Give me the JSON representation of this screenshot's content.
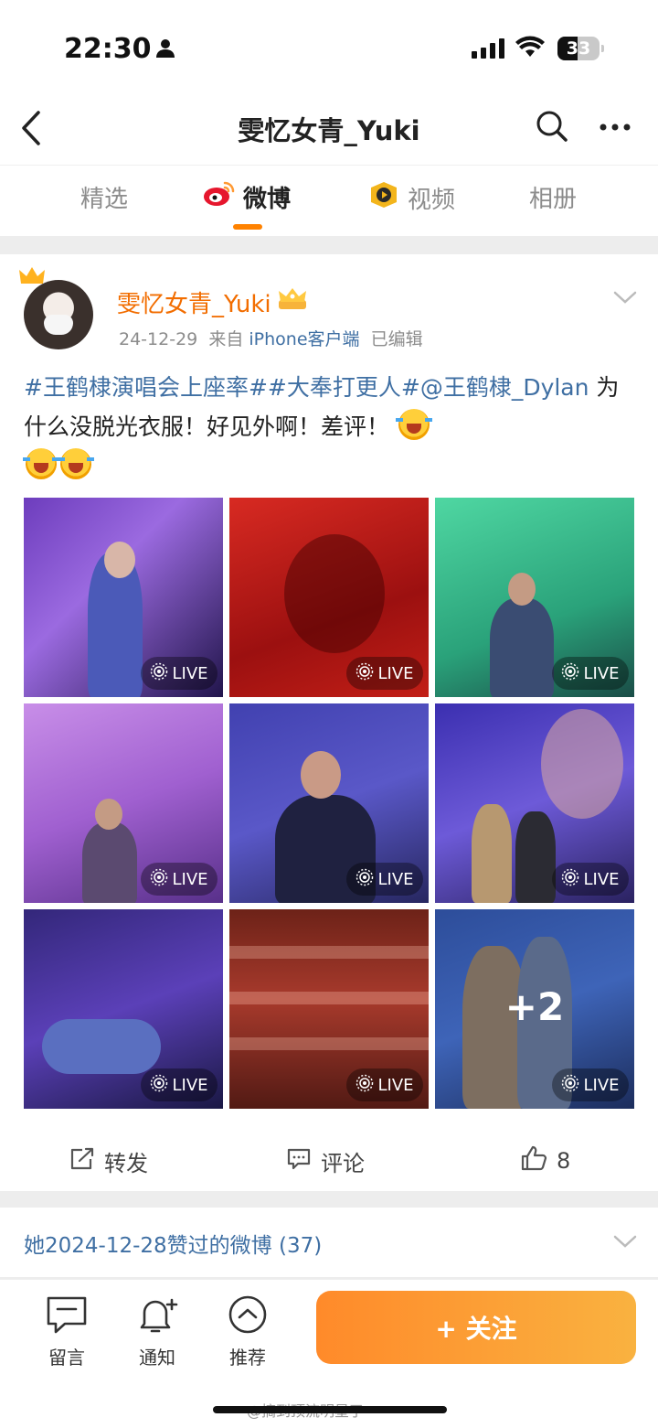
{
  "status_bar": {
    "time": "22:30",
    "battery": "33"
  },
  "navbar": {
    "title": "雯忆女青_Yuki"
  },
  "tabs": [
    {
      "label": "精选",
      "active": false
    },
    {
      "label": "微博",
      "active": true
    },
    {
      "label": "视频",
      "active": false
    },
    {
      "label": "相册",
      "active": false
    }
  ],
  "post": {
    "username": "雯忆女青_Yuki",
    "date": "24-12-29",
    "source_prefix": "来自",
    "source": "iPhone客户端",
    "edited": "已编辑",
    "text_tag1": "#王鹤棣演唱会上座率#",
    "text_tag2": "#大奉打更人#",
    "text_mention": "@王鹤棣_Dylan",
    "text_body": " 为什么没脱光衣服！好见外啊！差评！ ",
    "photo_badge": "LIVE",
    "more_count": "+2",
    "actions": {
      "repost": "转发",
      "comment": "评论",
      "like_count": "8"
    }
  },
  "liked_section": {
    "text": "她2024-12-28赞过的微博 (37)"
  },
  "bottom_bar": {
    "message": "留言",
    "notify": "通知",
    "recommend": "推荐",
    "follow": "+ 关注"
  },
  "watermark": "@搞到顶流明星了",
  "colors": {
    "accent": "#ff8200",
    "username": "#f26d00",
    "link": "#3f6fa3"
  }
}
